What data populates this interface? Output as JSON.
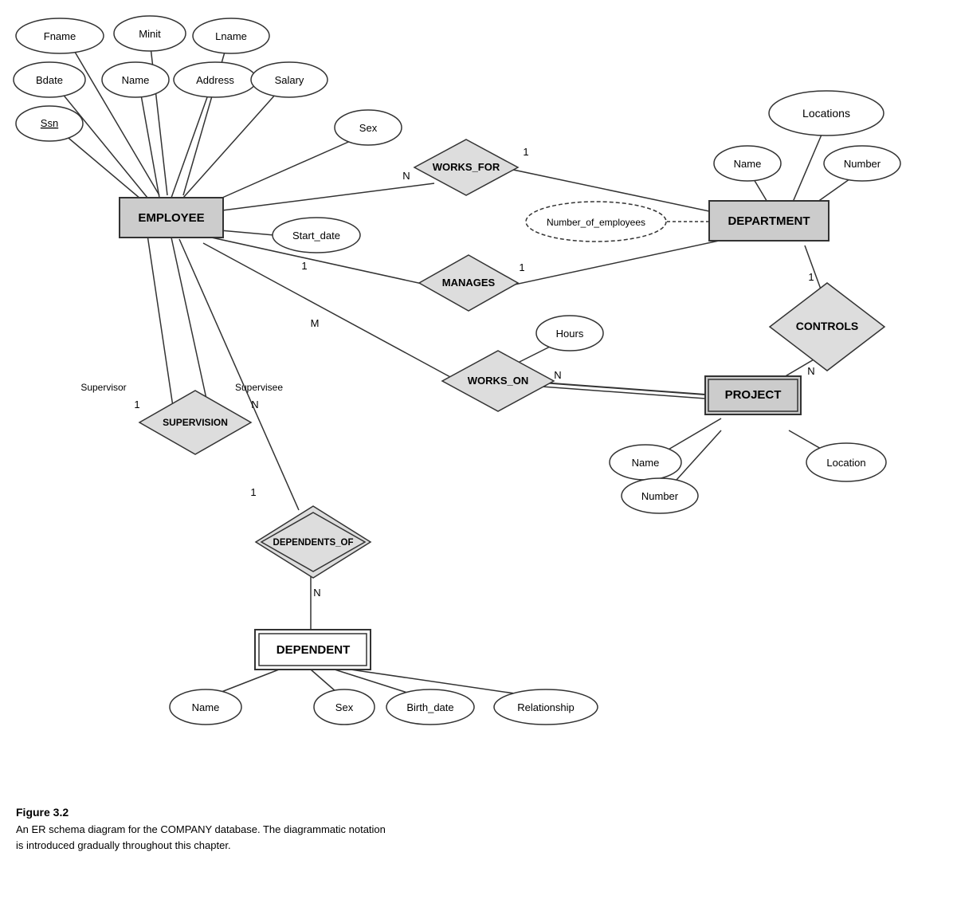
{
  "diagram": {
    "title": "Figure 3.2",
    "caption_line1": "An ER schema diagram for the COMPANY database. The diagrammatic notation",
    "caption_line2": "is introduced gradually throughout this chapter."
  },
  "entities": {
    "employee": "EMPLOYEE",
    "department": "DEPARTMENT",
    "project": "PROJECT",
    "dependent": "DEPENDENT"
  },
  "relationships": {
    "works_for": "WORKS_FOR",
    "manages": "MANAGES",
    "works_on": "WORKS_ON",
    "controls": "CONTROLS",
    "supervision": "SUPERVISION",
    "dependents_of": "DEPENDENTS_OF"
  },
  "attributes": {
    "fname": "Fname",
    "minit": "Minit",
    "lname": "Lname",
    "bdate": "Bdate",
    "name_emp": "Name",
    "address": "Address",
    "salary": "Salary",
    "ssn": "Ssn",
    "sex_emp": "Sex",
    "start_date": "Start_date",
    "number_of_employees": "Number_of_employees",
    "locations": "Locations",
    "dept_name": "Name",
    "dept_number": "Number",
    "hours": "Hours",
    "proj_name": "Name",
    "proj_number": "Number",
    "location": "Location",
    "dep_name": "Name",
    "dep_sex": "Sex",
    "birth_date": "Birth_date",
    "relationship": "Relationship"
  },
  "cardinalities": {
    "works_for_emp": "N",
    "works_for_dept": "1",
    "manages_emp": "1",
    "manages_dept": "1",
    "works_on_emp": "M",
    "works_on_proj": "N",
    "controls_dept": "1",
    "controls_proj": "N",
    "supervision_supervisor": "1",
    "supervision_supervisee": "N",
    "dependents_of_emp": "1",
    "dependents_of_dep": "N"
  }
}
